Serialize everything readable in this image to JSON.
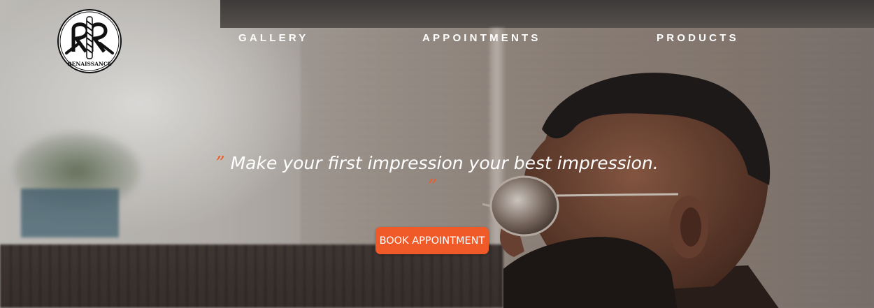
{
  "logo": {
    "text": "RENAISSANCE",
    "icon": "renaissance-logo-icon"
  },
  "nav": {
    "gallery": "GALLERY",
    "appointments": "APPOINTMENTS",
    "products": "PRODUCTS"
  },
  "hero": {
    "open_quote": "”",
    "tagline": "Make your first impression your best impression.",
    "close_quote": "”",
    "cta_label": "BOOK APPOINTMENT"
  },
  "colors": {
    "accent": "#f05a28",
    "nav_text": "#ffffff",
    "tagline_text": "#ffffff"
  }
}
